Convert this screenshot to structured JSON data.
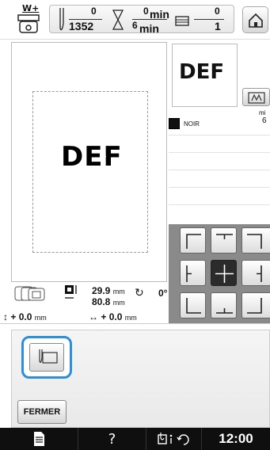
{
  "top_bar": {
    "presser_foot_label": "W+",
    "stitch_count_current": "0",
    "stitch_count_total": "1352",
    "time_current": "0",
    "time_total": "6",
    "time_unit": "min",
    "color_change_current": "0",
    "color_change_total": "1",
    "home_icon": "home-icon"
  },
  "preview": {
    "pattern_text": "DEF",
    "thumbnail_text": "DEF"
  },
  "thread": {
    "color_name": "NOIR",
    "color_hex": "#111111",
    "mi_label": "mi",
    "mi_value": "6"
  },
  "info": {
    "width_value": "29.9",
    "height_value": "80.8",
    "size_unit": "mm",
    "angle_value": "0°",
    "vertical_move": "0.0",
    "horizontal_move": "0.0",
    "move_unit": "mm",
    "move_sign": "+"
  },
  "controls": {
    "close_label": "FERMER",
    "needle_icon": "needle-position-icon"
  },
  "system_bar": {
    "doc_icon": "document-icon",
    "help_label": "?",
    "thread_icon": "thread-info-icon",
    "time": "12:00"
  },
  "colors": {
    "accent_blue": "#2d8fd8",
    "active_cell": "#2b2b2b",
    "grid_background": "#8a8a8a"
  }
}
